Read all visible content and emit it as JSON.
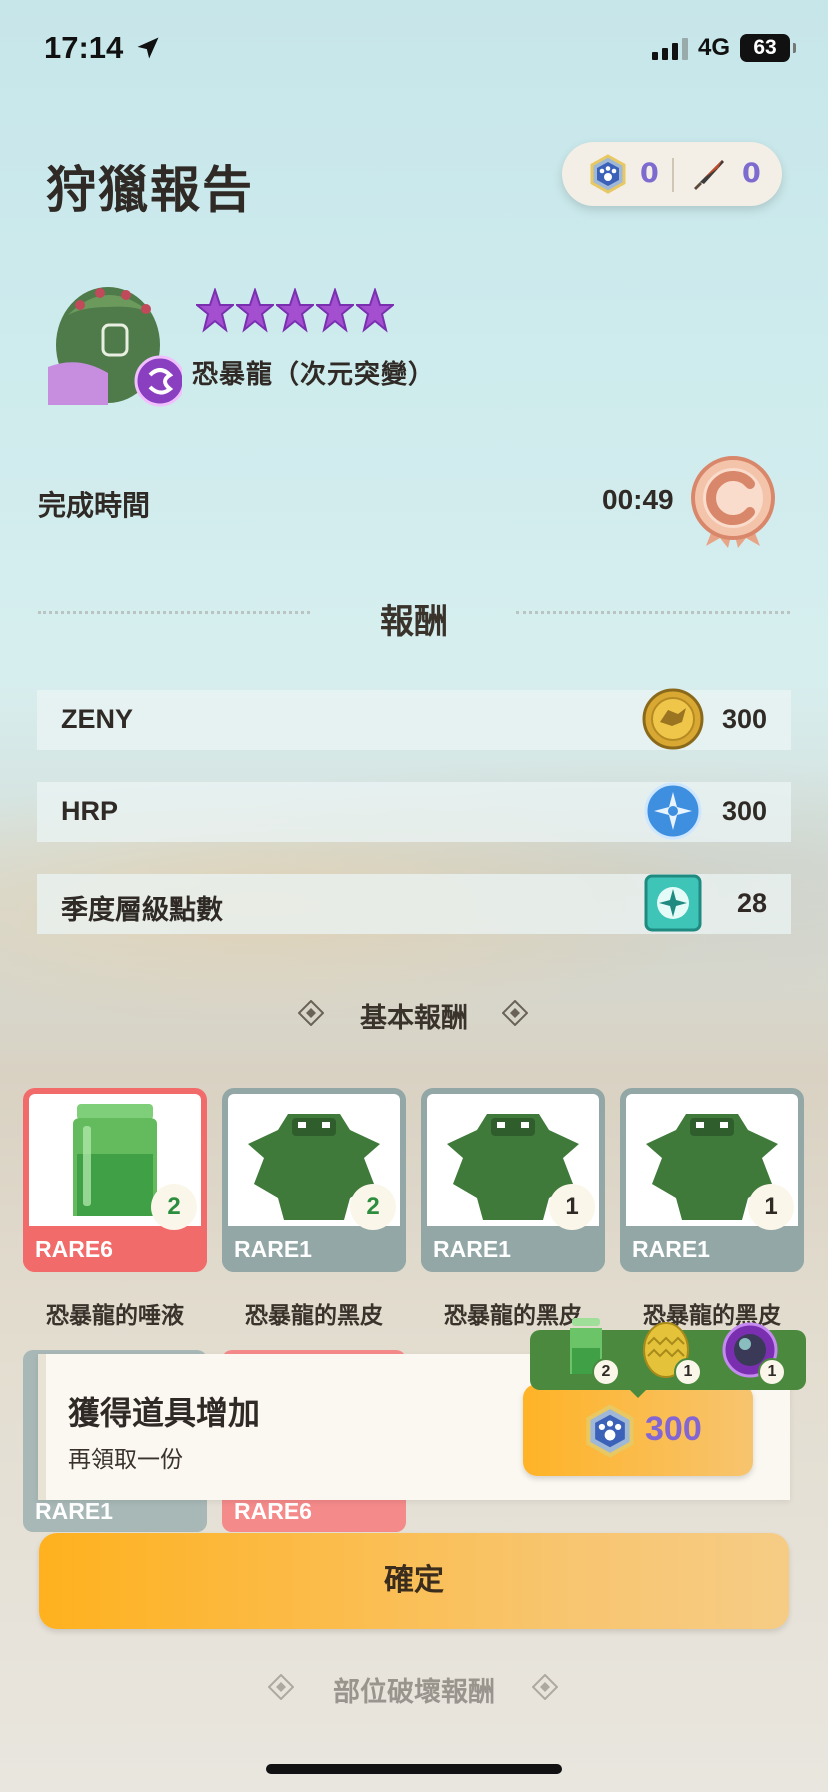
{
  "status_bar": {
    "time": "17:14",
    "network": "4G",
    "battery": "63"
  },
  "header": {
    "title": "狩獵報告"
  },
  "currency": {
    "pawn_value": "0",
    "blade_value": "0"
  },
  "monster": {
    "name": "恐暴龍（次元突變）",
    "stars": 5
  },
  "completion": {
    "label": "完成時間",
    "value": "00:49",
    "rank": "C"
  },
  "rewards": {
    "title": "報酬",
    "rows": [
      {
        "label": "ZENY",
        "value": "300",
        "icon": "zeny-coin-icon"
      },
      {
        "label": "HRP",
        "value": "300",
        "icon": "hrp-icon"
      },
      {
        "label": "季度層級點數",
        "value": "28",
        "icon": "season-tier-icon"
      }
    ]
  },
  "basic_rewards": {
    "title": "基本報酬",
    "items": [
      {
        "name": "恐暴龍的唾液",
        "rarity": "RARE6",
        "count": "2",
        "icon": "saliva-jar-icon"
      },
      {
        "name": "恐暴龍的黑皮",
        "rarity": "RARE1",
        "count": "2",
        "icon": "hide-icon"
      },
      {
        "name": "恐暴龍的黑皮",
        "rarity": "RARE1",
        "count": "1",
        "icon": "hide-icon"
      },
      {
        "name": "恐暴龍的黑皮",
        "rarity": "RARE1",
        "count": "1",
        "icon": "hide-icon"
      }
    ],
    "partial_items": [
      {
        "rarity": "RARE1"
      },
      {
        "rarity": "RARE6"
      }
    ]
  },
  "bonus_popup": {
    "title": "獲得道具增加",
    "subtitle": "再領取一份",
    "cost": "300",
    "bonus_items": [
      {
        "count": "2",
        "icon": "saliva-jar-icon"
      },
      {
        "count": "1",
        "icon": "golden-egg-icon"
      },
      {
        "count": "1",
        "icon": "dimension-orb-icon"
      }
    ]
  },
  "confirm": {
    "label": "確定"
  },
  "part_break": {
    "title": "部位破壞報酬"
  },
  "colors": {
    "rare6": "#f26b6b",
    "rare1": "#93a8a6",
    "accent_orange": "#ffb326",
    "currency_purple": "#7d6bd0",
    "count_green": "#2c8d3f"
  }
}
